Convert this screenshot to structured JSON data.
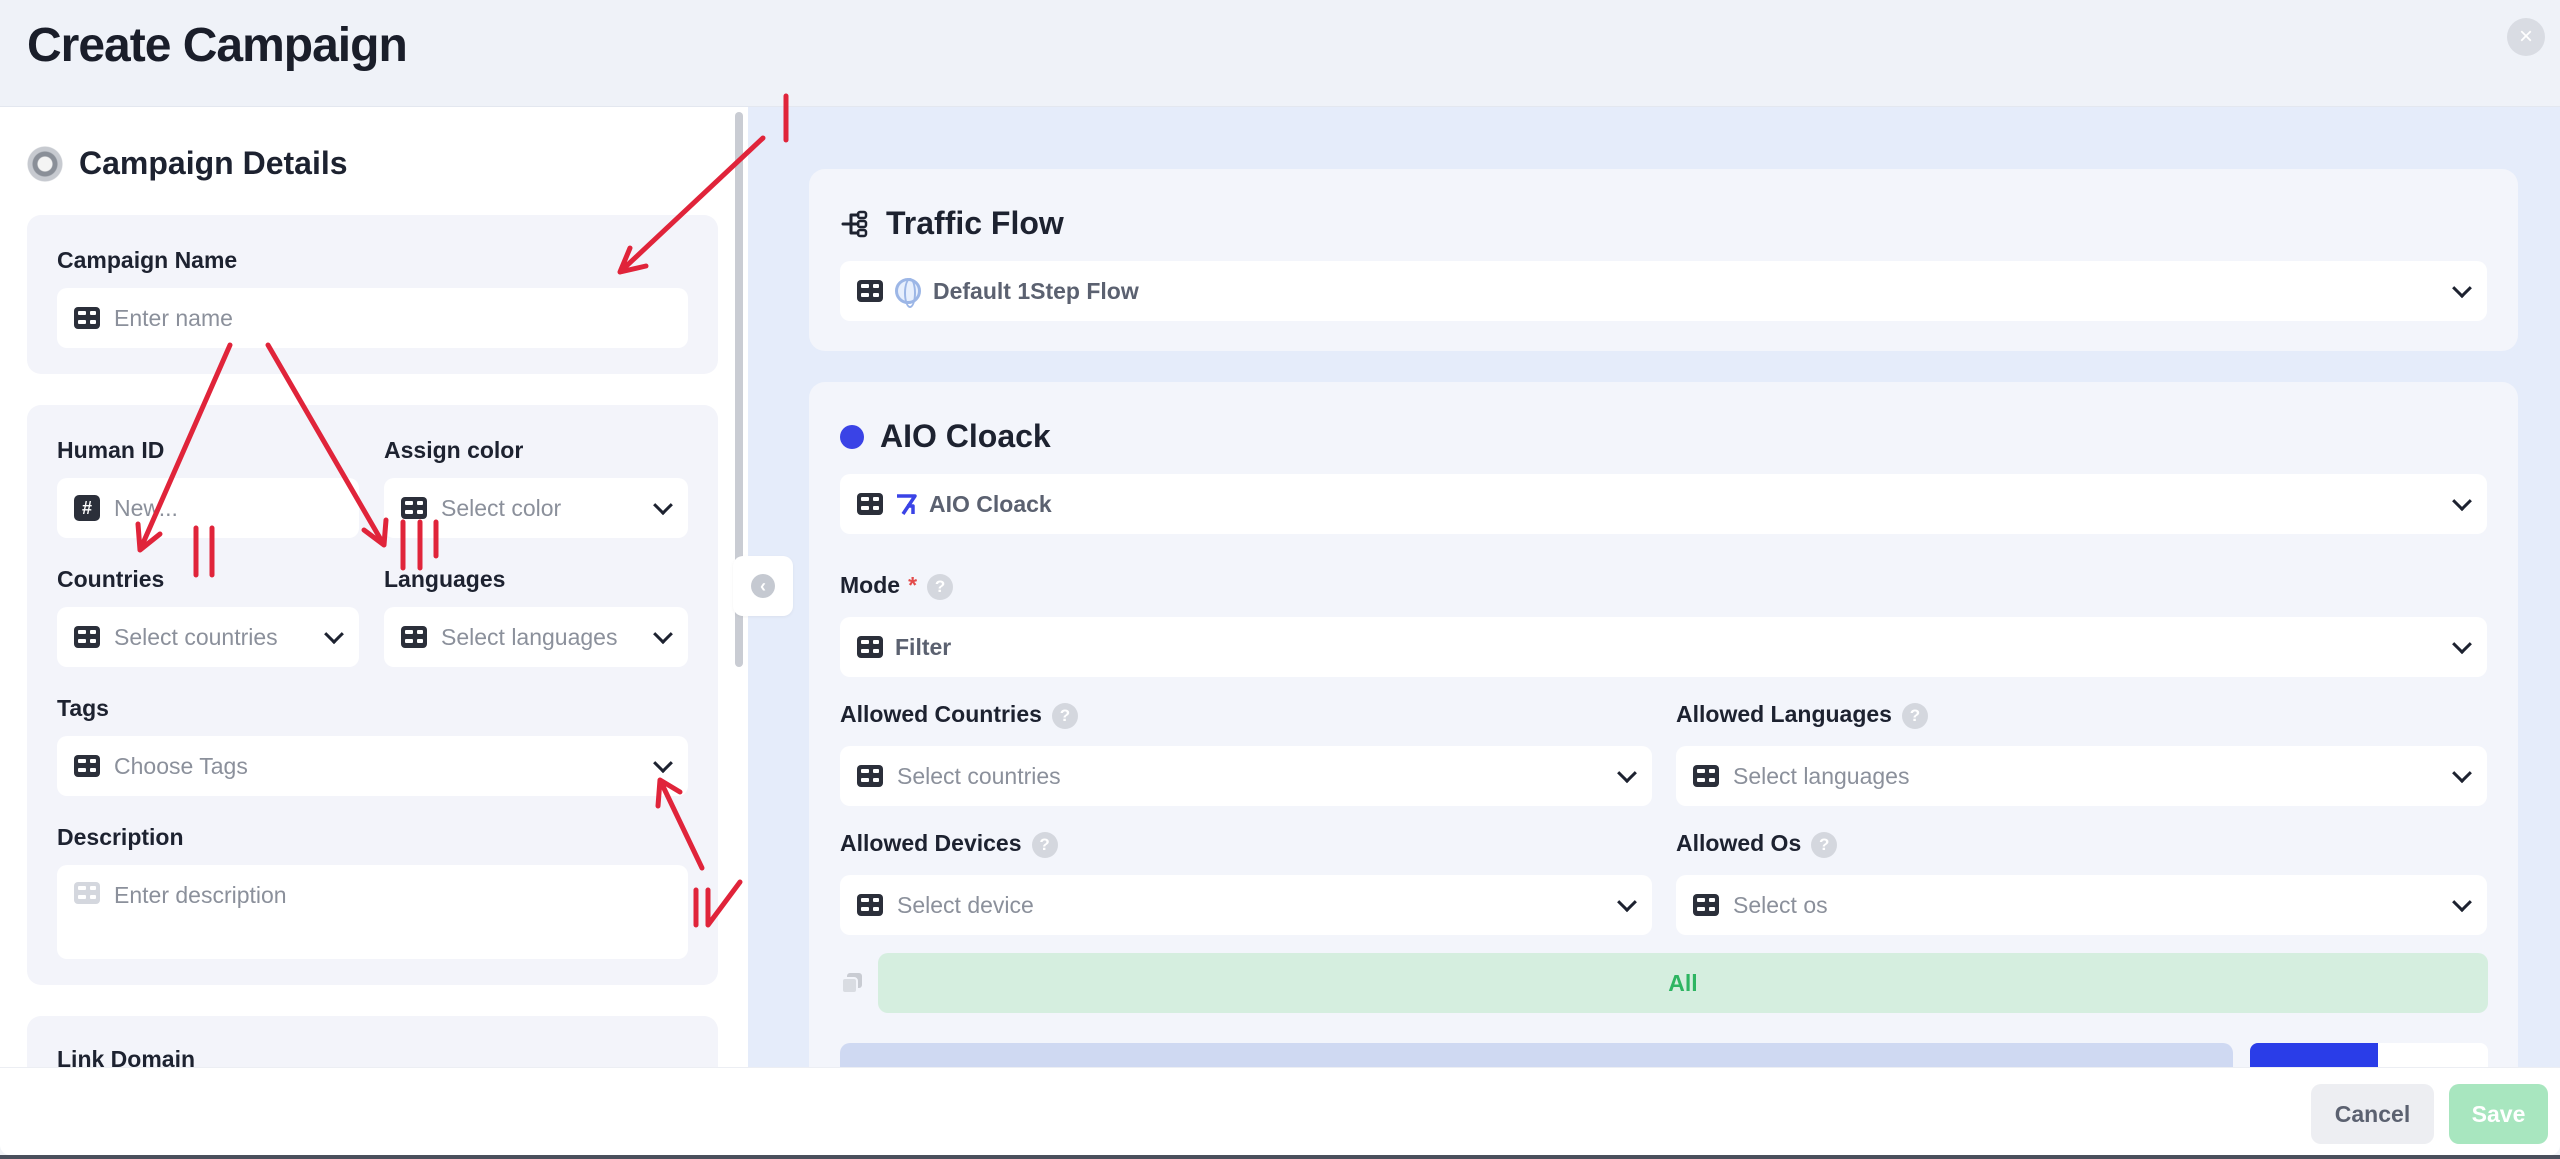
{
  "header": {
    "title": "Create Campaign",
    "close_icon": "close-icon"
  },
  "details": {
    "title": "Campaign Details",
    "campaign_name": {
      "label": "Campaign Name",
      "placeholder": "Enter name"
    },
    "human_id": {
      "label": "Human ID",
      "placeholder": "New..."
    },
    "assign_color": {
      "label": "Assign color",
      "placeholder": "Select color"
    },
    "countries": {
      "label": "Countries",
      "placeholder": "Select countries"
    },
    "languages": {
      "label": "Languages",
      "placeholder": "Select languages"
    },
    "tags": {
      "label": "Tags",
      "placeholder": "Choose Tags"
    },
    "description": {
      "label": "Description",
      "placeholder": "Enter description"
    },
    "link_domain": {
      "label": "Link Domain"
    }
  },
  "traffic_flow": {
    "title": "Traffic Flow",
    "value": "Default 1Step Flow"
  },
  "aio": {
    "title": "AIO Cloack",
    "value": "AIO Cloack",
    "accent": "#3a43e6",
    "mode": {
      "label": "Mode",
      "required": "*",
      "value": "Filter"
    },
    "allowed_countries": {
      "label": "Allowed Countries",
      "placeholder": "Select countries"
    },
    "allowed_languages": {
      "label": "Allowed Languages",
      "placeholder": "Select languages"
    },
    "allowed_devices": {
      "label": "Allowed Devices",
      "placeholder": "Select device"
    },
    "allowed_os": {
      "label": "Allowed Os",
      "placeholder": "Select os"
    },
    "all_label": "All",
    "help": "?"
  },
  "footer": {
    "cancel": "Cancel",
    "save": "Save",
    "save_color": "#a8e6bf"
  }
}
